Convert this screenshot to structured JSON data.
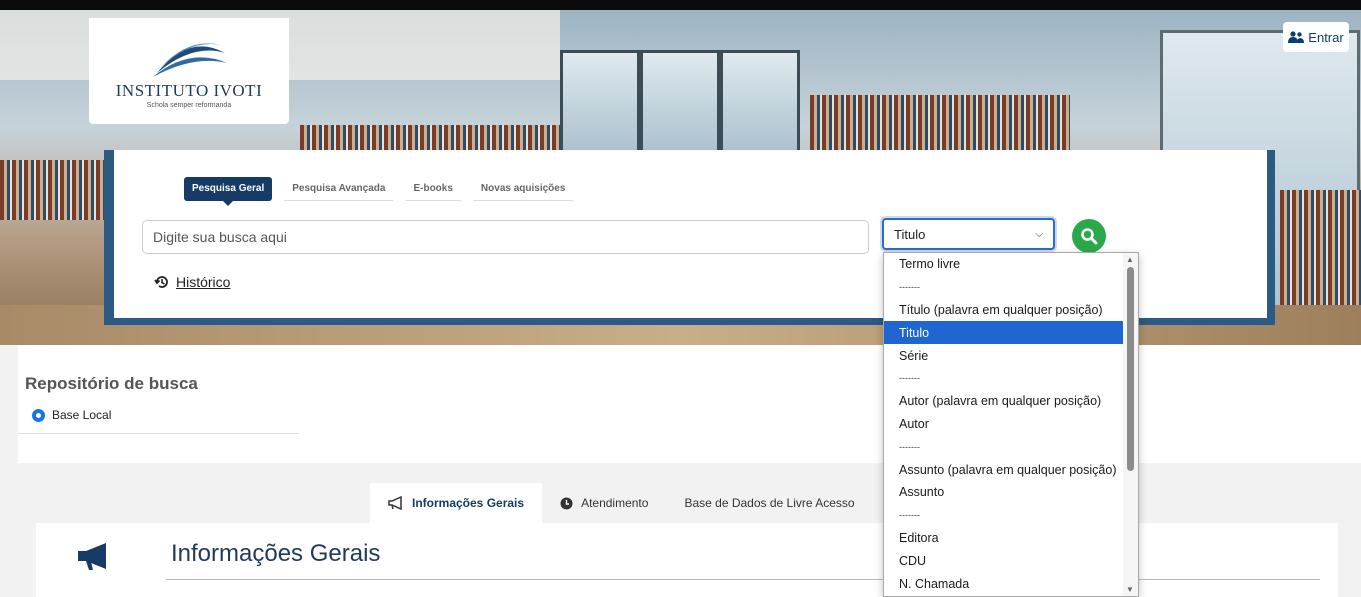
{
  "header": {
    "logo_title": "INSTITUTO IVOTI",
    "logo_subtitle": "Schola semper reformanda",
    "login_label": "Entrar",
    "login_icon": "user-group-icon"
  },
  "search": {
    "tabs": [
      {
        "label": "Pesquisa Geral",
        "active": true
      },
      {
        "label": "Pesquisa Avançada",
        "active": false
      },
      {
        "label": "E-books",
        "active": false
      },
      {
        "label": "Novas aquisições",
        "active": false
      }
    ],
    "placeholder": "Digite sua busca aqui",
    "field_selected": "Titulo",
    "history_label": "Histórico",
    "history_icon": "history-icon",
    "go_icon": "search-icon"
  },
  "dropdown": {
    "options": [
      {
        "label": "Termo livre",
        "separator": false,
        "selected": false
      },
      {
        "label": "-------",
        "separator": true,
        "selected": false
      },
      {
        "label": "Título (palavra em qualquer posição)",
        "separator": false,
        "selected": false
      },
      {
        "label": "Titulo",
        "separator": false,
        "selected": true
      },
      {
        "label": "Série",
        "separator": false,
        "selected": false
      },
      {
        "label": "-------",
        "separator": true,
        "selected": false
      },
      {
        "label": "Autor (palavra em qualquer posição)",
        "separator": false,
        "selected": false
      },
      {
        "label": "Autor",
        "separator": false,
        "selected": false
      },
      {
        "label": "-------",
        "separator": true,
        "selected": false
      },
      {
        "label": "Assunto (palavra em qualquer posição)",
        "separator": false,
        "selected": false
      },
      {
        "label": "Assunto",
        "separator": false,
        "selected": false
      },
      {
        "label": "-------",
        "separator": true,
        "selected": false
      },
      {
        "label": "Editora",
        "separator": false,
        "selected": false
      },
      {
        "label": "CDU",
        "separator": false,
        "selected": false
      },
      {
        "label": "N. Chamada",
        "separator": false,
        "selected": false
      }
    ]
  },
  "repository": {
    "title": "Repositório de busca",
    "option_label": "Base Local"
  },
  "info_tabs": [
    {
      "label": "Informações Gerais",
      "icon": "megaphone-icon",
      "active": true
    },
    {
      "label": "Atendimento",
      "icon": "clock-icon",
      "active": false
    },
    {
      "label": "Base de Dados de Livre Acesso",
      "icon": "",
      "active": false
    }
  ],
  "info_panel": {
    "heading": "Informações Gerais",
    "icon": "megaphone-icon"
  },
  "colors": {
    "navy": "#153b66",
    "panel_blue": "#2b5a83",
    "go_green": "#2aa84a",
    "select_highlight": "#1f66d1"
  }
}
